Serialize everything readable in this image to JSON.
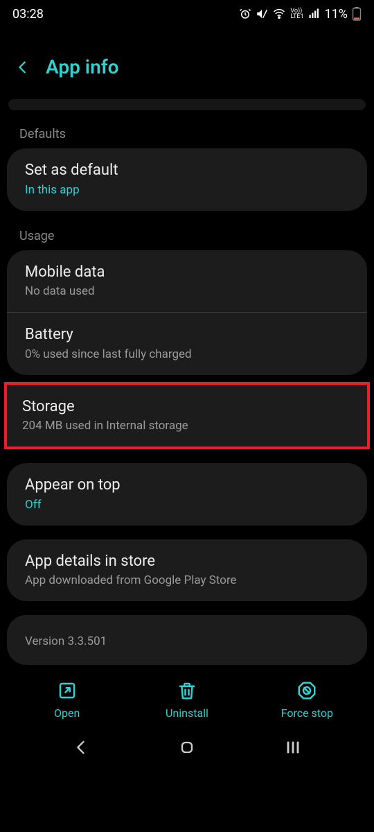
{
  "status": {
    "time": "03:28",
    "battery": "11%"
  },
  "header": {
    "title": "App info"
  },
  "sections": {
    "defaults_label": "Defaults",
    "set_default": {
      "title": "Set as default",
      "sub": "In this app"
    },
    "usage_label": "Usage",
    "mobile_data": {
      "title": "Mobile data",
      "sub": "No data used"
    },
    "battery": {
      "title": "Battery",
      "sub": "0% used since last fully charged"
    },
    "storage": {
      "title": "Storage",
      "sub": "204 MB used in Internal storage"
    },
    "appear_on_top": {
      "title": "Appear on top",
      "sub": "Off"
    },
    "app_details": {
      "title": "App details in store",
      "sub": "App downloaded from Google Play Store"
    },
    "version": {
      "text": "Version 3.3.501"
    }
  },
  "actions": {
    "open": "Open",
    "uninstall": "Uninstall",
    "force_stop": "Force stop"
  }
}
